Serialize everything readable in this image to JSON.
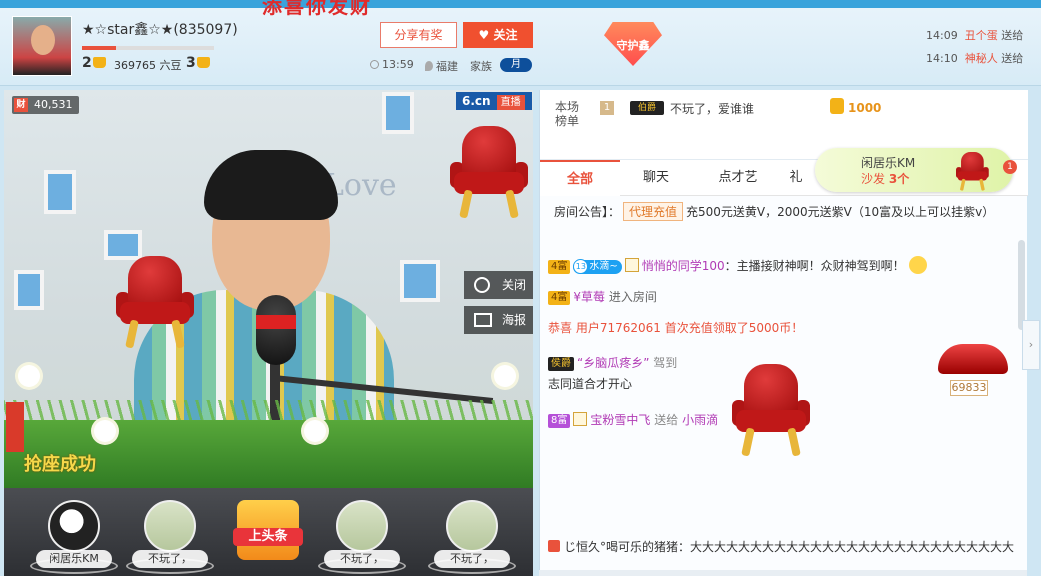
{
  "header": {
    "title": "添喜你发财",
    "anchor_name": "★☆star鑫☆★(835097)",
    "wealth_level": "2",
    "beans": "369765 六豆",
    "star_level": "3",
    "live_time": "13:59",
    "location": "福建",
    "family_label": "家族",
    "family_badge": "月",
    "share_label": "分享有奖",
    "follow_label": "♥ 关注",
    "guard_label": "守护鑫",
    "feed": [
      {
        "time": "14:09",
        "who": "丑个蛋",
        "action": "送给"
      },
      {
        "time": "14:10",
        "who": "神秘人",
        "action": "送给"
      }
    ]
  },
  "video": {
    "wealth_icon": "财",
    "wealth_count": "40,531",
    "brand": "6.cn",
    "live_tag": "直播",
    "close_label": "关闭",
    "poster_label": "海报",
    "wall_text": "Love",
    "success_text": "抢座成功"
  },
  "seats": [
    {
      "label": "闲居乐KM"
    },
    {
      "label": "不玩了，"
    },
    {
      "label": "上头条"
    },
    {
      "label": "不玩了，"
    },
    {
      "label": "不玩了，"
    }
  ],
  "rank": {
    "title": "本场榜单",
    "position": "1",
    "badge": "伯爵",
    "user": "不玩了，爱谁谁",
    "value": "1000"
  },
  "tabs": [
    "全部",
    "聊天",
    "点才艺",
    "礼"
  ],
  "sofa": {
    "name": "闲居乐KM",
    "label_prefix": "沙发",
    "count": "3个",
    "badge": "1"
  },
  "notice": {
    "prefix": "房间公告】：",
    "tag": "代理充值",
    "text": "充500元送黄V，2000元送紫V（10富及以上可以挂紫v）"
  },
  "messages": [
    {
      "level": "4富",
      "fan_level": "13",
      "fan_name": "水滴~",
      "user": "悄悄的同学100",
      "text": "：主播接财神啊！众财神驾到啊！"
    },
    {
      "level": "4富",
      "user": "¥草莓",
      "text": "进入房间"
    },
    {
      "text": "恭喜 用户71762061 首次充值领取了5000币！"
    },
    {
      "badge": "侯爵",
      "user": "“乡脑瓜疼乡”",
      "action": "驾到",
      "sub": "志同道合才开心",
      "gift_value": "69833"
    },
    {
      "level": "8富",
      "user": "宝粉雪中飞",
      "to": "送给",
      "target": "小雨滴"
    }
  ],
  "bottom_message": {
    "user": "じ恒久°喝可乐的猪猪",
    "text": "：大大大大大大大大大大大大大大大大大大大大大大大大大大大"
  }
}
